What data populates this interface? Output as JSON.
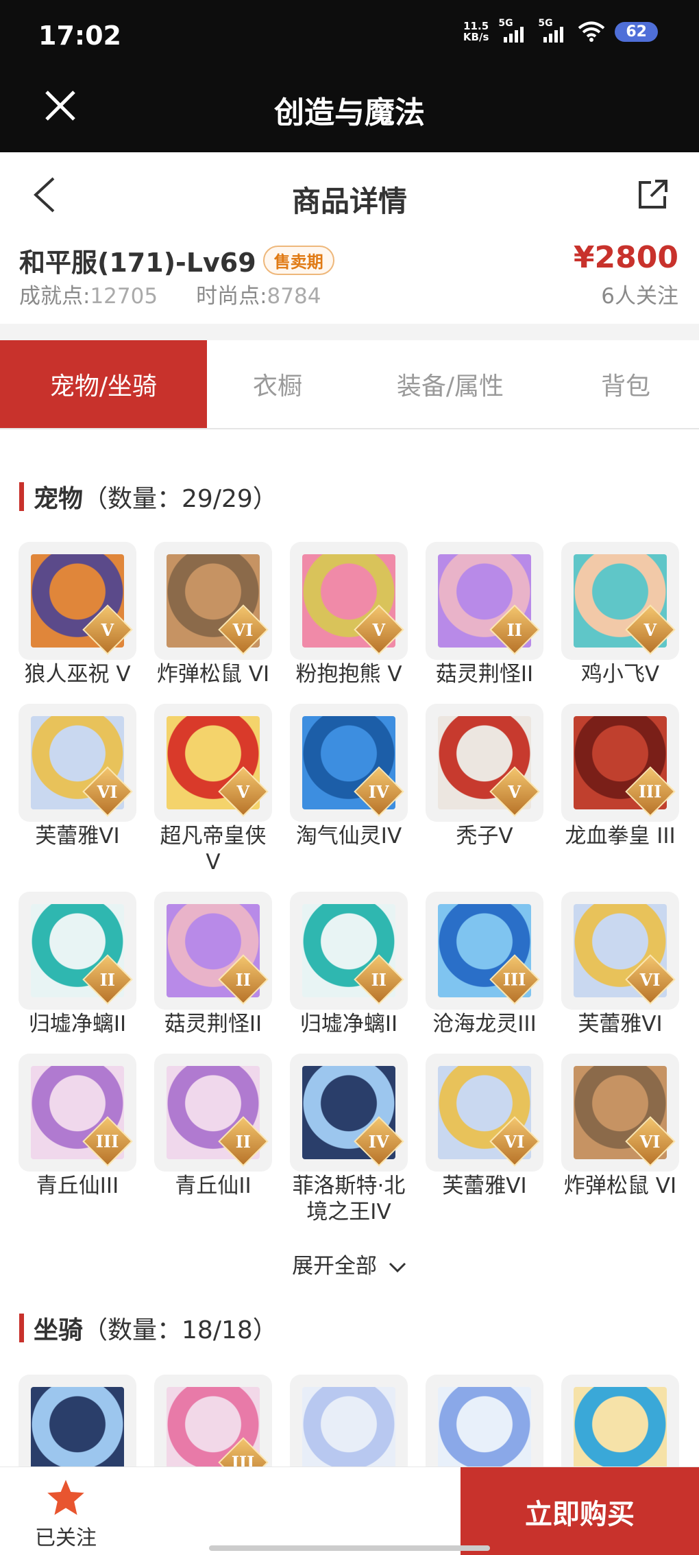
{
  "status_bar": {
    "time": "17:02",
    "speed_value": "11.5",
    "speed_unit": "KB/s",
    "signal_1": "5G",
    "signal_2": "5G",
    "battery": "62"
  },
  "app_header": {
    "title": "创造与魔法",
    "close_icon": "close-icon"
  },
  "nav": {
    "title": "商品详情",
    "back_icon": "chevron-left-icon",
    "share_icon": "share-icon"
  },
  "product": {
    "name": "和平服(171)-Lv69",
    "badge": "售卖期",
    "achievement_label": "成就点:",
    "achievement_value": "12705",
    "fashion_label": "时尚点:",
    "fashion_value": "8784",
    "price": "¥2800",
    "follows": "6人关注"
  },
  "tabs": [
    {
      "label": "宠物/坐骑",
      "active": true
    },
    {
      "label": "衣橱",
      "active": false
    },
    {
      "label": "装备/属性",
      "active": false
    },
    {
      "label": "背包",
      "active": false
    }
  ],
  "pets_section": {
    "title": "宠物",
    "count": "（数量：29/29）"
  },
  "pets": [
    {
      "name": "狼人巫祝 V",
      "rank": "V"
    },
    {
      "name": "炸弹松鼠 VI",
      "rank": "VI"
    },
    {
      "name": "粉抱抱熊 V",
      "rank": "V"
    },
    {
      "name": "菇灵荆怪II",
      "rank": "II"
    },
    {
      "name": "鸡小飞V",
      "rank": "V"
    },
    {
      "name": "芙蕾雅VI",
      "rank": "VI"
    },
    {
      "name": "超凡帝皇侠V",
      "rank": "V"
    },
    {
      "name": "淘气仙灵IV",
      "rank": "IV"
    },
    {
      "name": "秃子V",
      "rank": "V"
    },
    {
      "name": "龙血拳皇 III",
      "rank": "III"
    },
    {
      "name": "归墟净螭II",
      "rank": "II"
    },
    {
      "name": "菇灵荆怪II",
      "rank": "II"
    },
    {
      "name": "归墟净螭II",
      "rank": "II"
    },
    {
      "name": "沧海龙灵III",
      "rank": "III"
    },
    {
      "name": "芙蕾雅VI",
      "rank": "VI"
    },
    {
      "name": "青丘仙III",
      "rank": "III"
    },
    {
      "name": "青丘仙II",
      "rank": "II"
    },
    {
      "name": "菲洛斯特·北境之王IV",
      "rank": "IV"
    },
    {
      "name": "芙蕾雅VI",
      "rank": "VI"
    },
    {
      "name": "炸弹松鼠 VI",
      "rank": "VI"
    }
  ],
  "expand_label": "展开全部",
  "mounts_section": {
    "title": "坐骑",
    "count": "（数量：18/18）"
  },
  "mounts": [
    {
      "rank": ""
    },
    {
      "rank": "III"
    },
    {
      "rank": ""
    },
    {
      "rank": ""
    },
    {
      "rank": ""
    }
  ],
  "bottom": {
    "follow_label": "已关注",
    "buy_label": "立即购买"
  },
  "colors": {
    "accent": "#c8322c",
    "badge": "#e07a14"
  }
}
